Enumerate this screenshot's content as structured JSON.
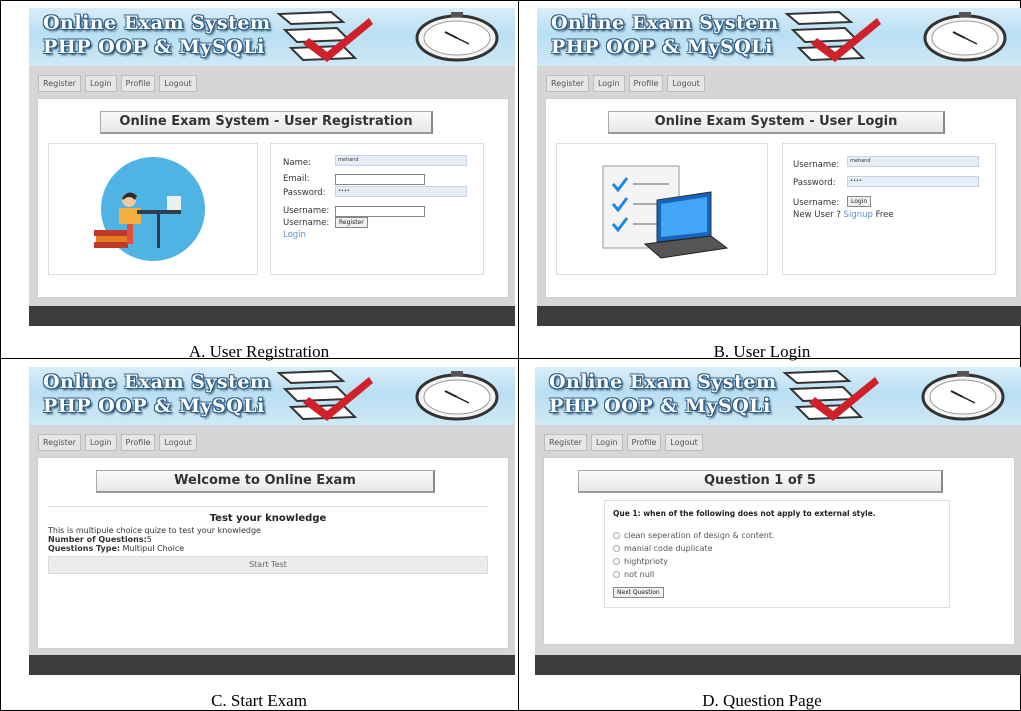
{
  "banner": {
    "line1": "Online Exam System",
    "line2": "PHP OOP & MySQLi"
  },
  "nav": [
    "Register",
    "Login",
    "Profile",
    "Logout"
  ],
  "panels": {
    "a": {
      "caption": "A.   User Registration",
      "title": "Online Exam System - User Registration",
      "form": {
        "name_label": "Name:",
        "name_value": "mehand",
        "email_label": "Email:",
        "password_label": "Password:",
        "password_value": "••••",
        "username_label": "Username:",
        "username2_label": "Username:",
        "register_button": "Register",
        "login_link": "Login"
      }
    },
    "b": {
      "caption": "B.   User Login",
      "title": "Online Exam System - User Login",
      "form": {
        "username_label": "Username:",
        "username_value": "mehand",
        "password_label": "Password:",
        "password_value": "••••",
        "username2_label": "Username:",
        "login_button": "Login",
        "newuser_prefix": "New User ?",
        "signup_link": "Signup",
        "newuser_suffix": "Free"
      }
    },
    "c": {
      "caption": "C.   Start Exam",
      "title": "Welcome to Online Exam",
      "heading": "Test your knowledge",
      "desc": "This is multipule choice quize to test your knowledge",
      "num_label": "Number of Questions:",
      "num_value": "5",
      "type_label": "Questions Type:",
      "type_value": "Multipul Choice",
      "start_button": "Start Test"
    },
    "d": {
      "caption": "D.   Question Page",
      "title": "Question 1 of 5",
      "question": "Que 1: when of the following does not apply to external style.",
      "options": [
        "clean seperation of design & content.",
        "manial code duplicate",
        "hightprioty",
        "not null"
      ],
      "next_button": "Next Question"
    }
  },
  "colors": {
    "footer": "#3c3c3c",
    "nav_bg": "#d6d6d6",
    "link": "#5b8fd1",
    "banner_text_stroke": "#2d5f8a",
    "check": "#d0202a"
  }
}
